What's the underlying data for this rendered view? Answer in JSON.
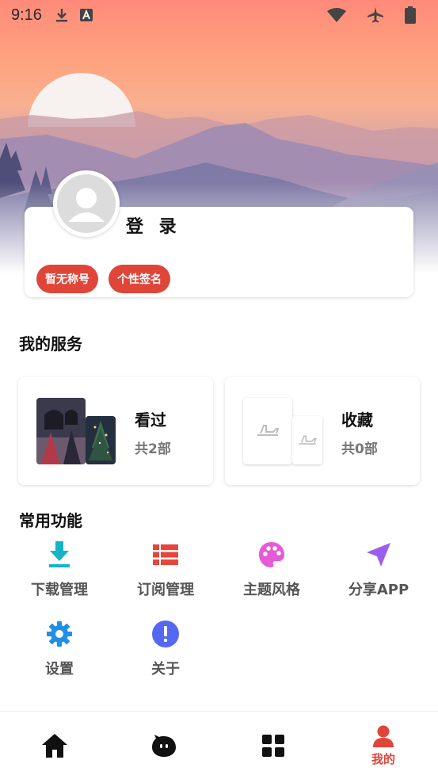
{
  "status_bar": {
    "time": "9:16",
    "icons": [
      "download-icon",
      "app-a-icon",
      "wifi-icon",
      "airplane-icon",
      "battery-icon"
    ]
  },
  "profile": {
    "login_label": "登 录",
    "chips": [
      "暂无称号",
      "个性签名"
    ]
  },
  "services": {
    "title": "我的服务",
    "cards": [
      {
        "label": "看过",
        "count": "共2部"
      },
      {
        "label": "收藏",
        "count": "共0部"
      }
    ]
  },
  "functions": {
    "title": "常用功能",
    "items": [
      {
        "label": "下载管理",
        "icon": "download-icon",
        "color": "#14b4c8"
      },
      {
        "label": "订阅管理",
        "icon": "list-icon",
        "color": "#e8453a"
      },
      {
        "label": "主题风格",
        "icon": "palette-icon",
        "color": "#e55ad6"
      },
      {
        "label": "分享APP",
        "icon": "send-icon",
        "color": "#9b5cf0"
      },
      {
        "label": "设置",
        "icon": "gear-icon",
        "color": "#1f8fe8"
      },
      {
        "label": "关于",
        "icon": "info-icon",
        "color": "#5468f2"
      }
    ]
  },
  "bottom_nav": {
    "items": [
      {
        "icon": "home-icon",
        "label": ""
      },
      {
        "icon": "mascot-icon",
        "label": ""
      },
      {
        "icon": "grid-icon",
        "label": ""
      },
      {
        "icon": "user-icon",
        "label": "我的"
      }
    ],
    "active_color": "#e0453a"
  },
  "colors": {
    "accent": "#e0453a",
    "muted_text": "#777777"
  }
}
